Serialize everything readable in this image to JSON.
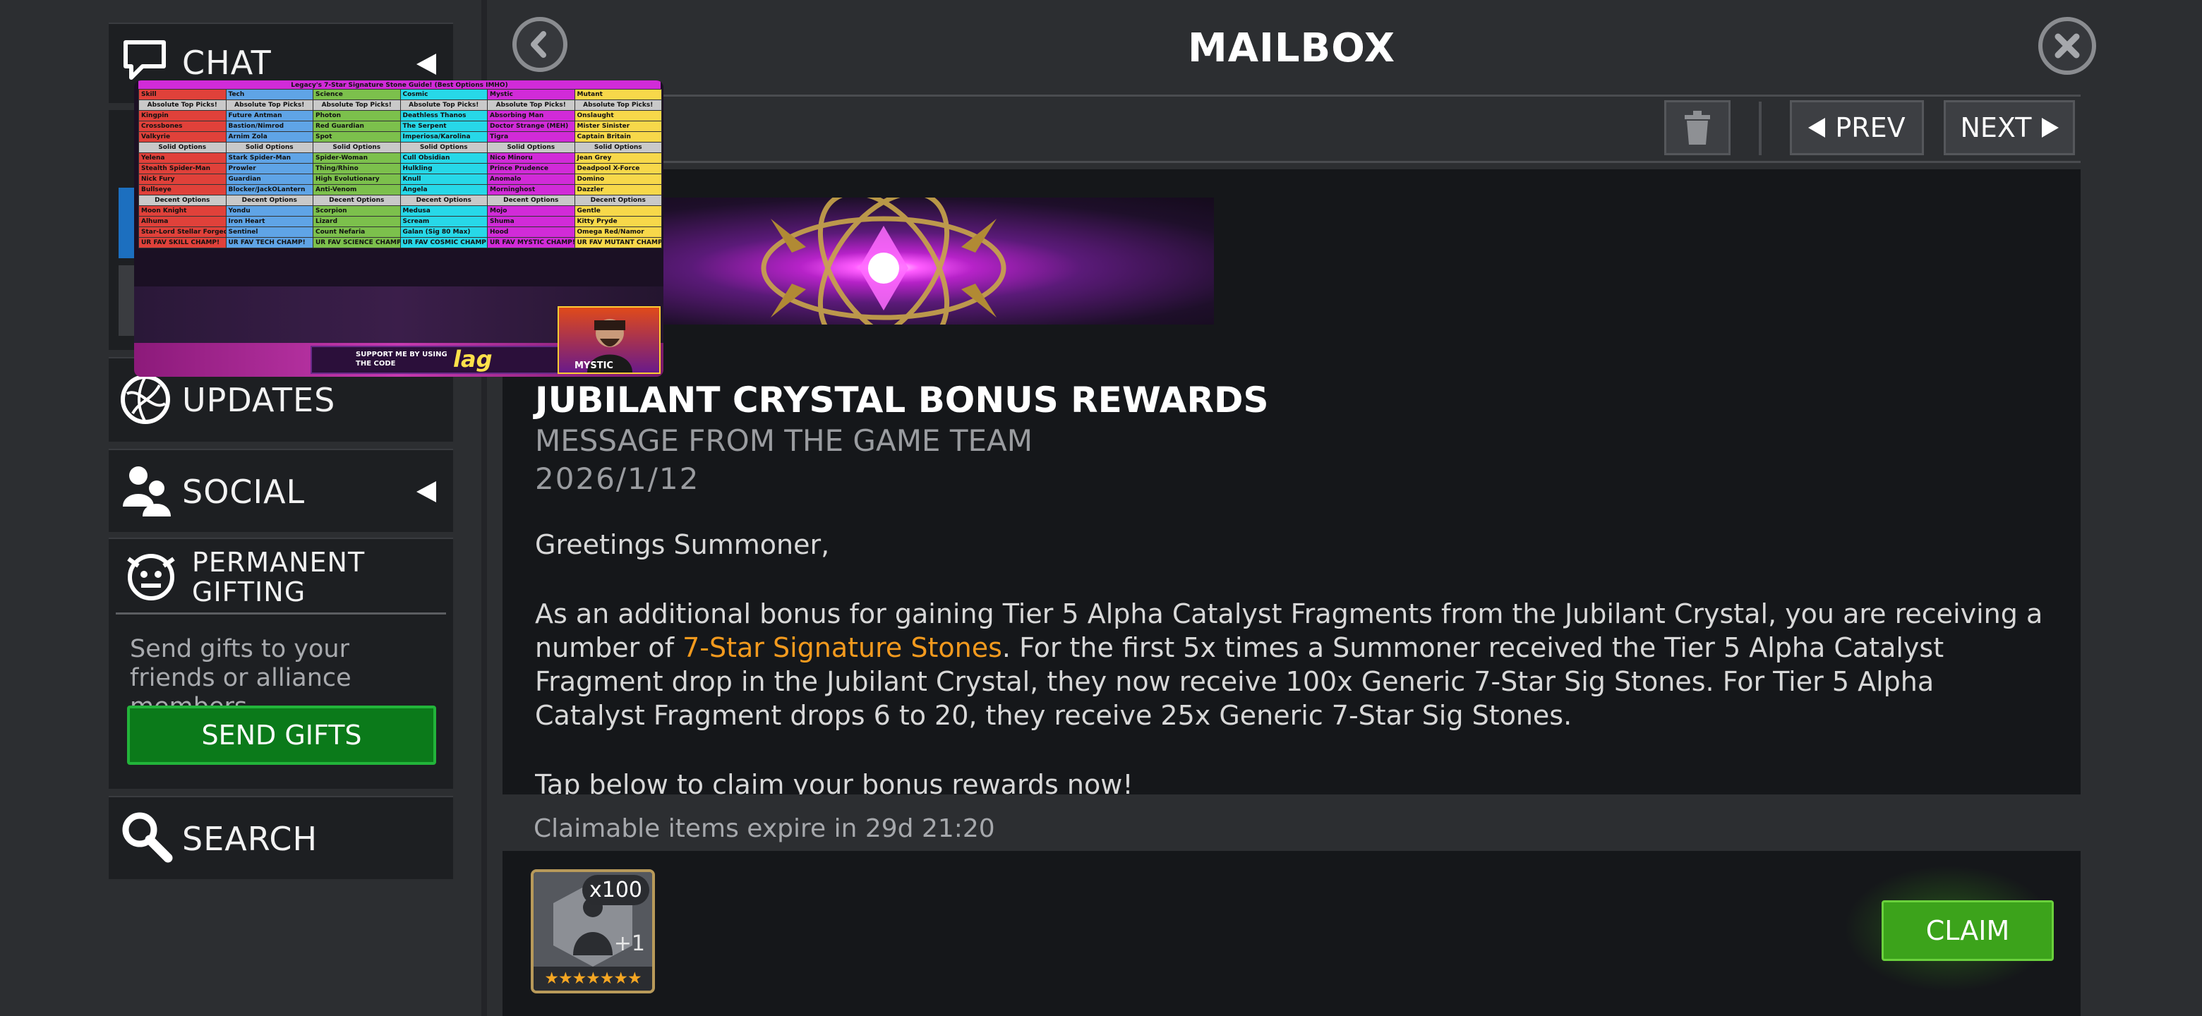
{
  "sidebar": {
    "chat": {
      "label": "CHAT",
      "icon": "chat-bubble-icon"
    },
    "updates": {
      "label": "UPDATES",
      "icon": "globe-icon"
    },
    "social": {
      "label": "SOCIAL",
      "icon": "people-icon"
    },
    "gifting": {
      "label": "PERMANENT GIFTING",
      "icon": "gift-mascot-icon",
      "description": "Send gifts to your friends or alliance members.",
      "button": "SEND GIFTS"
    },
    "search": {
      "label": "SEARCH",
      "icon": "magnifier-icon"
    }
  },
  "header": {
    "title": "MAILBOX",
    "prev_label": "PREV",
    "next_label": "NEXT"
  },
  "message": {
    "title": "JUBILANT CRYSTAL BONUS REWARDS",
    "subtitle": "MESSAGE FROM THE GAME TEAM",
    "date": "2026/1/12",
    "greeting": "Greetings Summoner,",
    "p1_a": "As an additional bonus for gaining Tier 5 Alpha Catalyst Fragments from the Jubilant Crystal, you are receiving a number of ",
    "p1_link": "7-Star Signature Stones",
    "p1_b": ". For the first 5x times a Summoner received the Tier 5 Alpha Catalyst Fragment drop in the Jubilant Crystal, they now receive 100x Generic 7-Star Sig Stones. For Tier 5 Alpha Catalyst Fragment drops 6 to 20, they receive 25x Generic 7-Star Sig Stones.",
    "p2": "Tap below to claim your bonus rewards now!"
  },
  "rewards": {
    "expiry": "Claimable items expire in 29d 21:20",
    "item_count": "x100",
    "item_plus": "+1",
    "stars": "★★★★★★★",
    "claim_label": "CLAIM"
  },
  "overlay": {
    "title": "Legacy's 7-Star Signature Stone Guide! (Best Options IMHO)",
    "classes": [
      "Skill",
      "Tech",
      "Science",
      "Cosmic",
      "Mystic",
      "Mutant"
    ],
    "row_absolute": "Absolute Top Picks!",
    "row_solid": "Solid Options",
    "row_decent": "Decent Options",
    "top_picks": [
      [
        "Kingpin",
        "Future Antman",
        "Photon",
        "Deathless Thanos",
        "Absorbing Man",
        "Onslaught"
      ],
      [
        "Crossbones",
        "Bastion/Nimrod",
        "Red Guardian",
        "The Serpent",
        "Doctor Strange (MEH)",
        "Mister Sinister"
      ],
      [
        "Valkyrie",
        "Arnim Zola",
        "Spot",
        "Imperiosa/Karolina",
        "Tigra",
        "Captain Britain"
      ]
    ],
    "solid": [
      [
        "Yelena",
        "Stark Spider-Man",
        "Spider-Woman",
        "Cull Obsidian",
        "Nico Minoru",
        "Jean Grey"
      ],
      [
        "Stealth Spider-Man",
        "Prowler",
        "Thing/Rhino",
        "Hulkling",
        "Prince Prudence",
        "Deadpool X-Force"
      ],
      [
        "Nick Fury",
        "Guardian",
        "High Evolutionary",
        "Knull",
        "Anomalo",
        "Domino"
      ],
      [
        "Bullseye",
        "Blocker/JackOLantern",
        "Anti-Venom",
        "Angela",
        "Morninghost",
        "Dazzler"
      ]
    ],
    "decent": [
      [
        "Moon Knight",
        "Yondu",
        "Scorpion",
        "Medusa",
        "Mojo",
        "Gentle"
      ],
      [
        "Alhuma",
        "Iron Heart",
        "Lizard",
        "Scream",
        "Shuma",
        "Kitty Pryde"
      ],
      [
        "Star-Lord Stellar Forged",
        "Sentinel",
        "Count Nefaria",
        "Galan (Sig 80 Max)",
        "Hood",
        "Omega Red/Namor"
      ]
    ],
    "favs": [
      "UR FAV SKILL CHAMP!",
      "UR FAV TECH CHAMP!",
      "UR FAV SCIENCE CHAMP!",
      "UR FAV COSMIC CHAMP!",
      "UR FAV MYSTIC CHAMP!",
      "UR FAV MUTANT CHAMP!"
    ],
    "support_text": "SUPPORT ME BY USING THE CODE",
    "code": "lag",
    "streamer_tag": "MYSTIC"
  },
  "colors": {
    "send_gifts_green": "#0b7a1a",
    "claim_green": "#3ca31b",
    "link_orange": "#f39a1e"
  }
}
